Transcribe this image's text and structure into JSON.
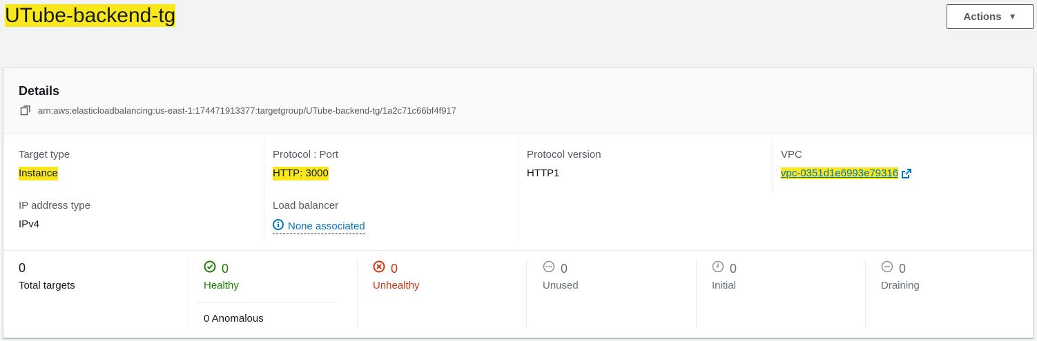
{
  "page": {
    "title": "UTube-backend-tg"
  },
  "actions": {
    "label": "Actions"
  },
  "details": {
    "title": "Details",
    "arn": "arn:aws:elasticloadbalancing:us-east-1:174471913377:targetgroup/UTube-backend-tg/1a2c71c66bf4f917",
    "target_type_label": "Target type",
    "target_type_value": "Instance",
    "protocol_port_label": "Protocol : Port",
    "protocol_port_value": "HTTP: 3000",
    "protocol_version_label": "Protocol version",
    "protocol_version_value": "HTTP1",
    "vpc_label": "VPC",
    "vpc_value": "vpc-0351d1e6993e79316",
    "ip_type_label": "IP address type",
    "ip_type_value": "IPv4",
    "lb_label": "Load balancer",
    "lb_value": "None associated"
  },
  "stats": {
    "total": {
      "value": "0",
      "label": "Total targets"
    },
    "healthy": {
      "value": "0",
      "label": "Healthy",
      "anomalous": "0 Anomalous"
    },
    "unhealthy": {
      "value": "0",
      "label": "Unhealthy"
    },
    "unused": {
      "value": "0",
      "label": "Unused"
    },
    "initial": {
      "value": "0",
      "label": "Initial"
    },
    "draining": {
      "value": "0",
      "label": "Draining"
    }
  },
  "colors": {
    "highlight": "#f8e71c",
    "link": "#0073bb",
    "healthy": "#1d8102",
    "unhealthy": "#d13212"
  }
}
